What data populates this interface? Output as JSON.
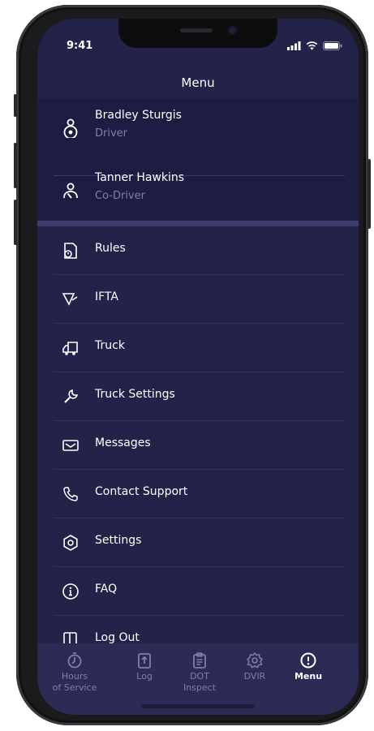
{
  "status_bar": {
    "time": "9:41"
  },
  "header": {
    "title": "Menu"
  },
  "drivers": [
    {
      "name": "Bradley Sturgis",
      "role": "Driver",
      "icon": "driver-icon"
    },
    {
      "name": "Tanner Hawkins",
      "role": "Co-Driver",
      "icon": "co-driver-icon"
    }
  ],
  "menu_items": [
    {
      "label": "Rules",
      "icon": "rules-icon"
    },
    {
      "label": "IFTA",
      "icon": "ifta-icon"
    },
    {
      "label": "Truck",
      "icon": "truck-icon"
    },
    {
      "label": "Truck Settings",
      "icon": "wrench-icon"
    },
    {
      "label": "Messages",
      "icon": "mail-icon"
    },
    {
      "label": "Contact Support",
      "icon": "phone-icon"
    },
    {
      "label": "Settings",
      "icon": "gear-icon"
    },
    {
      "label": "FAQ",
      "icon": "info-icon"
    },
    {
      "label": "Log Out",
      "icon": "logout-icon"
    }
  ],
  "tabs": [
    {
      "line1": "Hours",
      "line2": "of Service",
      "icon": "hours-of-service-icon",
      "active": false
    },
    {
      "line1": "Log",
      "line2": "",
      "icon": "log-icon",
      "active": false
    },
    {
      "line1": "DOT",
      "line2": "Inspect",
      "icon": "dot-inspect-icon",
      "active": false
    },
    {
      "line1": "DVIR",
      "line2": "",
      "icon": "dvir-icon",
      "active": false
    },
    {
      "line1": "Menu",
      "line2": "",
      "icon": "menu-icon",
      "active": true
    }
  ],
  "colors": {
    "background": "#23234a",
    "panel": "#1d1d44",
    "tabbar": "#2b2b55",
    "muted_text": "#7d7fa3",
    "text": "#ffffff"
  }
}
